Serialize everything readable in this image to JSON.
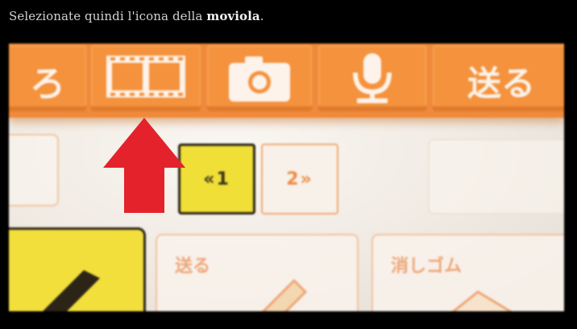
{
  "caption": {
    "prefix": "Selezionate quindi l'icona della ",
    "emphasis": "moviola",
    "suffix": "."
  },
  "toolbar": {
    "items": [
      {
        "name": "previous-glyph-button",
        "label": "ろ",
        "icon": "hiragana-glyph"
      },
      {
        "name": "filmstrip-button",
        "label": "",
        "icon": "filmstrip-icon"
      },
      {
        "name": "camera-button",
        "label": "",
        "icon": "camera-icon"
      },
      {
        "name": "microphone-button",
        "label": "",
        "icon": "microphone-icon"
      },
      {
        "name": "send-button",
        "label": "送る",
        "icon": "send-glyph"
      }
    ]
  },
  "pager": {
    "prev_label": "«1",
    "next_label": "2»",
    "active": 1
  },
  "tools": {
    "send_label": "送る",
    "eraser_label": "消しゴム"
  },
  "colors": {
    "toolbar_orange": "#f08a3a",
    "highlight_yellow": "#f0df37",
    "arrow_red": "#e3222b",
    "screen_white": "#f3efe9"
  }
}
